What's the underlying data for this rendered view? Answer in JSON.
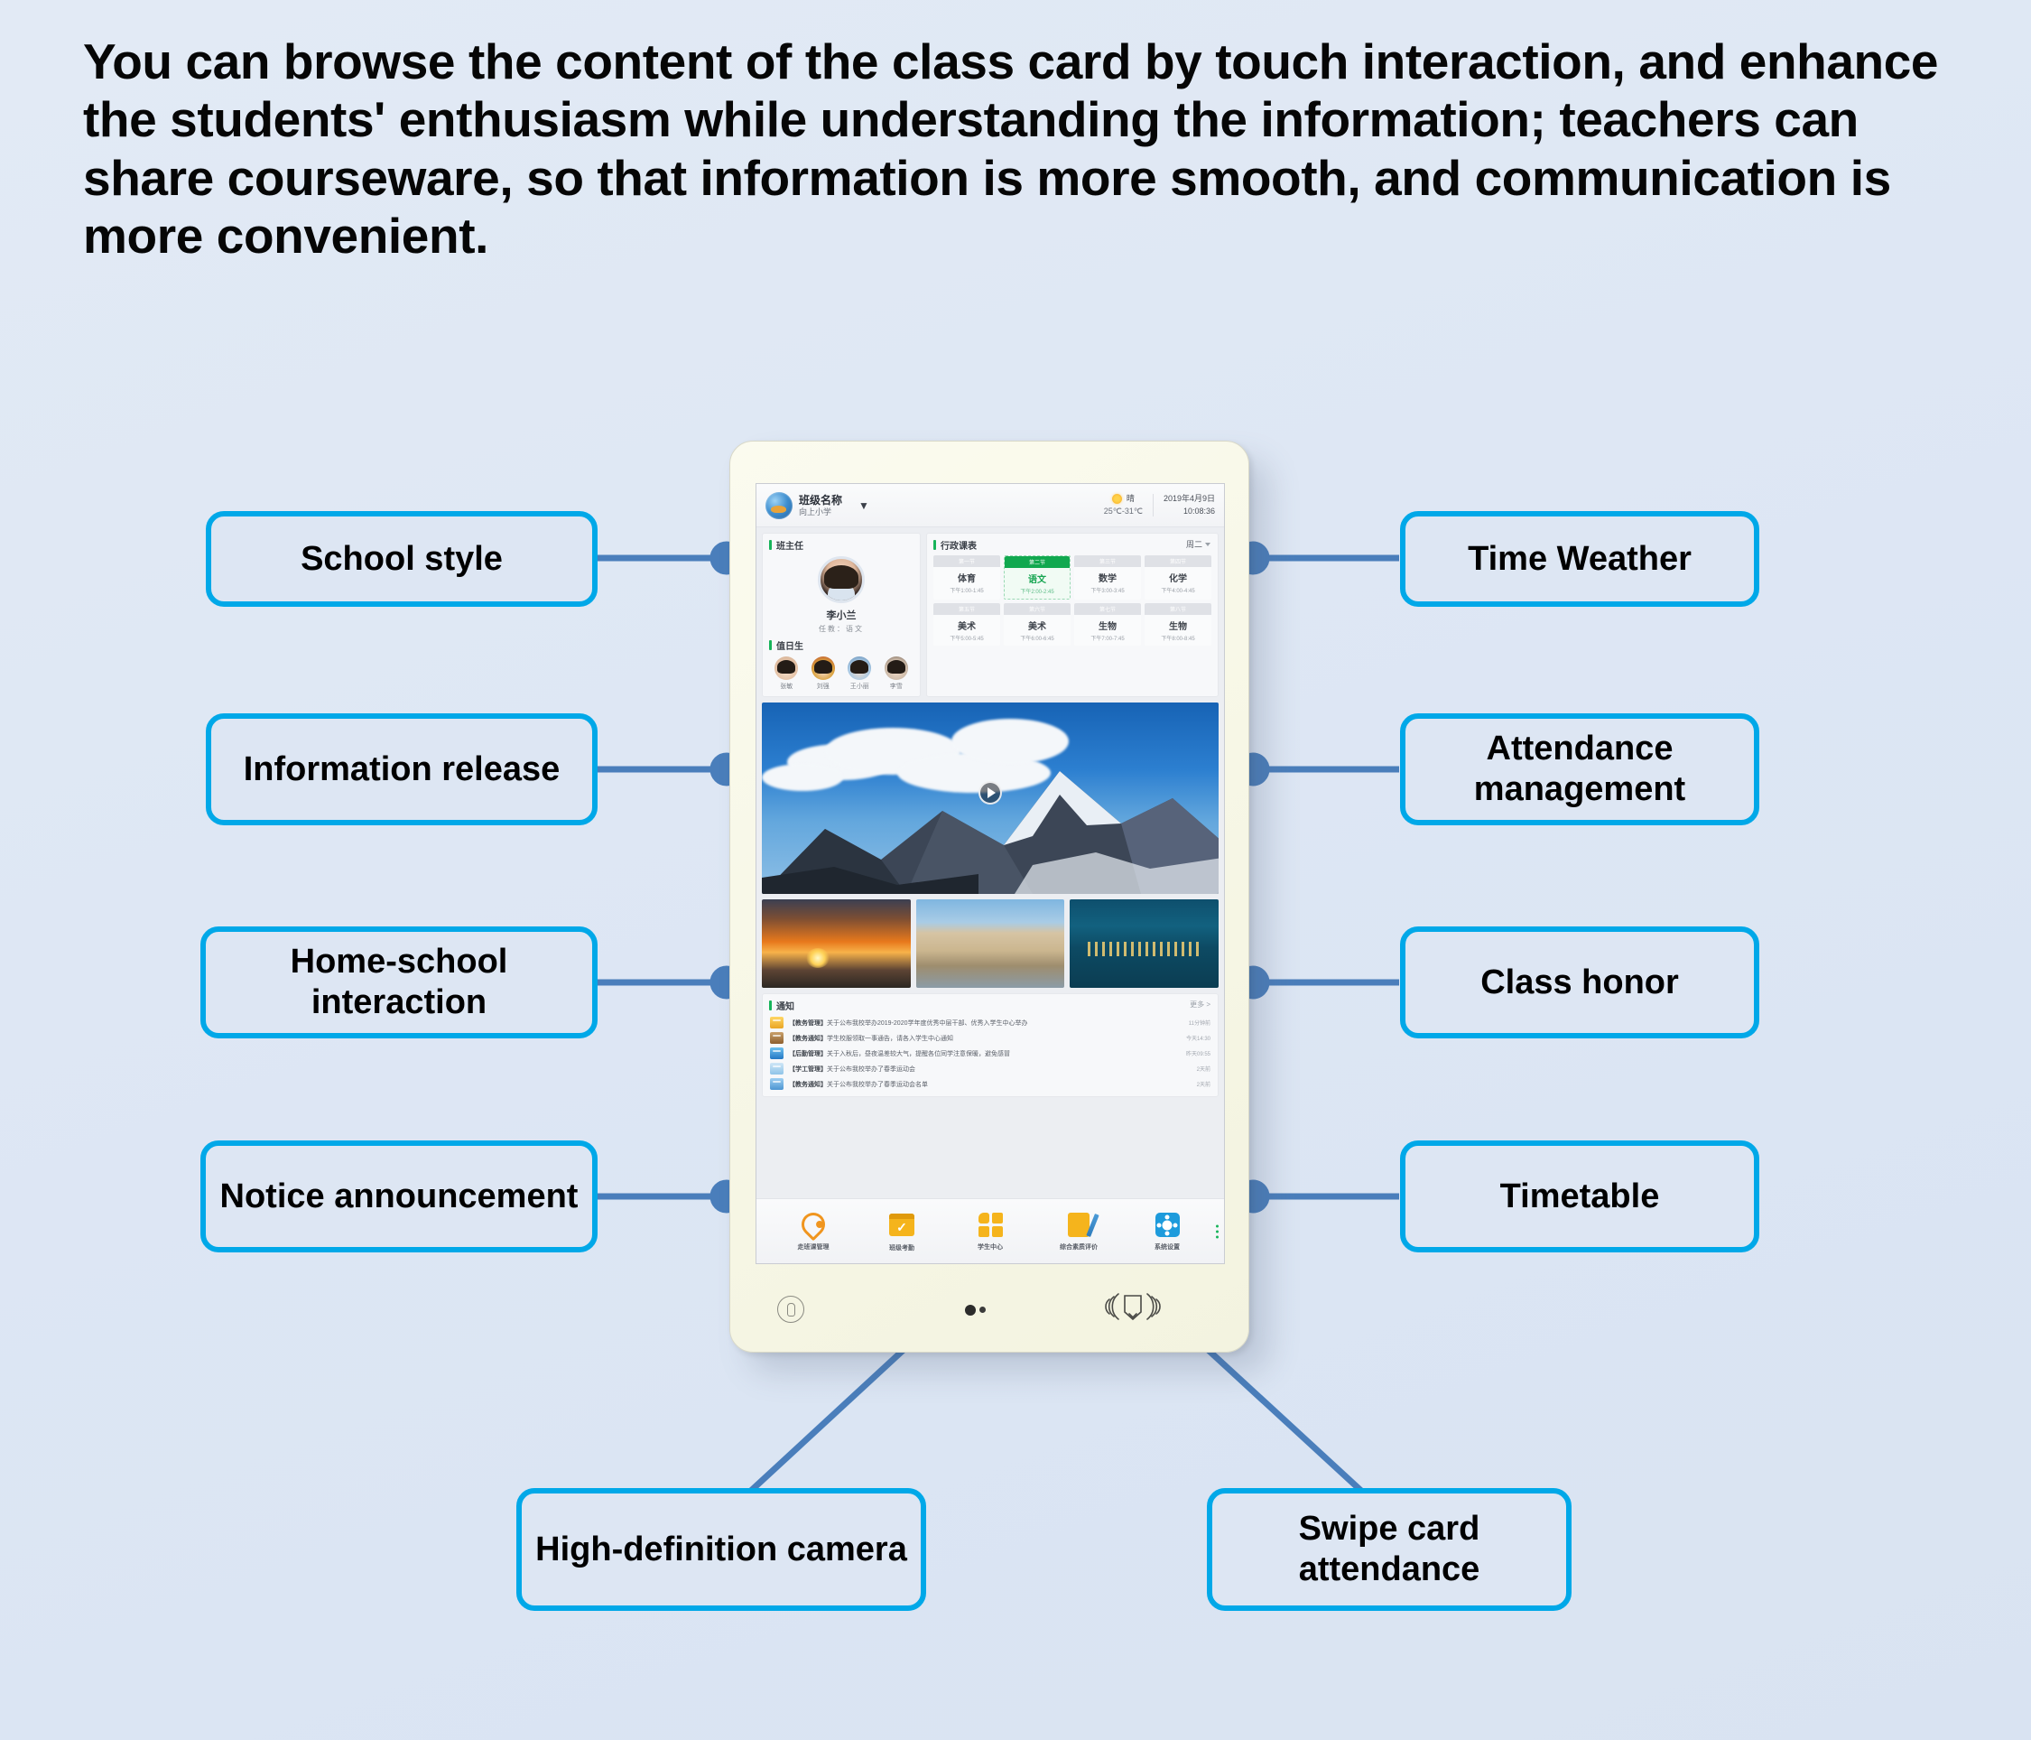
{
  "heading": "You can browse the content of the class card by touch interaction, and enhance the students' enthusiasm while understanding the information; teachers can share courseware, so that information is more smooth, and communication is more convenient.",
  "colors": {
    "background": "#dde6f3",
    "label_border": "#00a8e8",
    "connector": "#4a7ebb",
    "device_frame": "#f7f7e6",
    "accent_green": "#17b45a",
    "accent_orange": "#f5b41c",
    "accent_blue": "#1d9bdc"
  },
  "callouts": {
    "left": [
      {
        "label": "School style",
        "name": "school-style"
      },
      {
        "label": "Information release",
        "name": "information-release"
      },
      {
        "label": "Home-school interaction",
        "name": "home-school-interaction"
      },
      {
        "label": "Notice announcement",
        "name": "notice-announcement"
      }
    ],
    "right": [
      {
        "label": "Time Weather",
        "name": "time-weather"
      },
      {
        "label": "Attendance management",
        "name": "attendance-management"
      },
      {
        "label": "Class honor",
        "name": "class-honor"
      },
      {
        "label": "Timetable",
        "name": "timetable"
      }
    ],
    "bottom": [
      {
        "label": "High-definition camera",
        "name": "high-definition-camera"
      },
      {
        "label": "Swipe card attendance",
        "name": "swipe-card-attendance"
      }
    ]
  },
  "device": {
    "statusbar": {
      "logo_icon": "school-badge-icon",
      "class_name": "班级名称",
      "school_name": "向上小学",
      "wifi_icon": "wifi-icon",
      "weather_icon": "sun-icon",
      "weather_text": "晴",
      "temperature": "25℃-31℃",
      "date": "2019年4月9日",
      "time": "10:08:36"
    },
    "teacher_card": {
      "title": "班主任",
      "avatar": "teacher-avatar",
      "name": "李小兰",
      "subtitle": "任教：语文",
      "duty_title": "值日生",
      "students": [
        {
          "name": "张敏",
          "avatar": "student-avatar-1"
        },
        {
          "name": "刘强",
          "avatar": "student-avatar-2"
        },
        {
          "name": "王小丽",
          "avatar": "student-avatar-3"
        },
        {
          "name": "李雪",
          "avatar": "student-avatar-4"
        }
      ]
    },
    "schedule": {
      "title": "行政课表",
      "week_selector": "周二",
      "cells": [
        {
          "period": "第一节",
          "subject": "体育",
          "time": "下午1:00-1:45",
          "active": false
        },
        {
          "period": "第二节",
          "subject": "语文",
          "time": "下午2:00-2:45",
          "active": true
        },
        {
          "period": "第三节",
          "subject": "数学",
          "time": "下午3:00-3:45",
          "active": false
        },
        {
          "period": "第四节",
          "subject": "化学",
          "time": "下午4:00-4:45",
          "active": false
        },
        {
          "period": "第五节",
          "subject": "美术",
          "time": "下午5:00-5:45",
          "active": false
        },
        {
          "period": "第六节",
          "subject": "美术",
          "time": "下午6:00-6:45",
          "active": false
        },
        {
          "period": "第七节",
          "subject": "生物",
          "time": "下午7:00-7:45",
          "active": false
        },
        {
          "period": "第八节",
          "subject": "生物",
          "time": "下午8:00-8:45",
          "active": false
        }
      ]
    },
    "hero": {
      "image": "snow-mountain-photo",
      "play_button": "play-icon"
    },
    "thumbnails": [
      {
        "image": "sunset-photo"
      },
      {
        "image": "lakeside-village-photo"
      },
      {
        "image": "night-town-photo"
      }
    ],
    "notices": {
      "title": "通知",
      "more": "更多 >",
      "rows": [
        {
          "icon": "folder-icon",
          "tag": "【教务管理】",
          "text": "关于公布我校举办2019-2020学年度优秀中层干部、优秀入学生中心举办",
          "time": "11分钟前"
        },
        {
          "icon": "package-icon",
          "tag": "【教务通知】",
          "text": "学生校服领取一事通告，请各入学生中心通知",
          "time": "今天14:30"
        },
        {
          "icon": "cloud-icon",
          "tag": "【后勤管理】",
          "text": "关于入秋后，昼夜温差较大气，提醒各位同学注意保暖，避免感冒",
          "time": "昨天09:55"
        },
        {
          "icon": "weather-icon",
          "tag": "【学工管理】",
          "text": "关于公布我校举办了春季运动会",
          "time": "2天前"
        },
        {
          "icon": "badge-icon",
          "tag": "【教务通知】",
          "text": "关于公布我校举办了春季运动会名单",
          "time": "2天前"
        }
      ]
    },
    "navbar": {
      "items": [
        {
          "icon": "clock-pin-icon",
          "label": "走班课管理"
        },
        {
          "icon": "calendar-check-icon",
          "label": "班级考勤"
        },
        {
          "icon": "grid-icon",
          "label": "学生中心"
        },
        {
          "icon": "note-pen-icon",
          "label": "综合素质评价"
        },
        {
          "icon": "gear-icon",
          "label": "系统设置"
        }
      ],
      "overflow_icon": "more-dots-icon"
    },
    "hardware": {
      "mic_icon": "microphone-icon",
      "camera_icon": "camera-lens-dot",
      "nfc_icon": "card-reader-icon"
    }
  }
}
